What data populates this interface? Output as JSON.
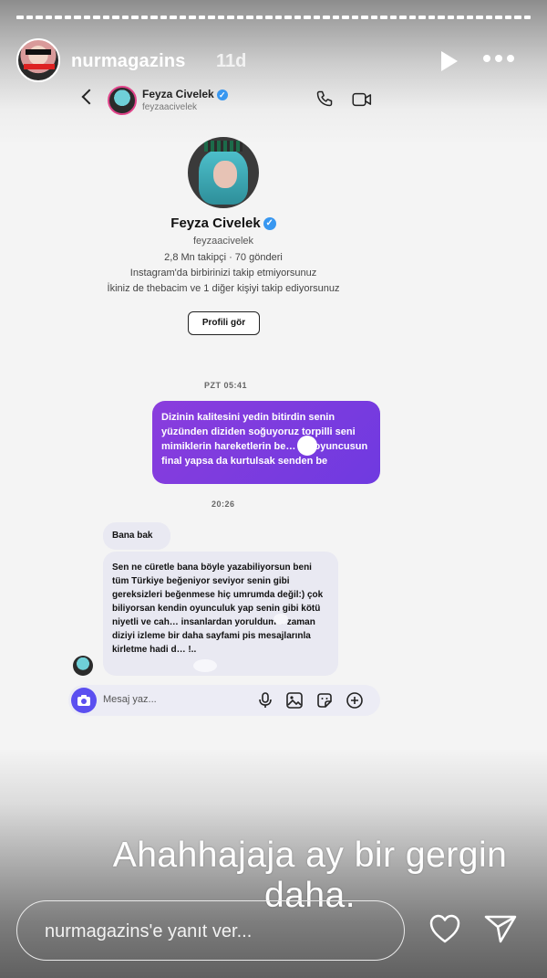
{
  "story": {
    "username": "nurmagazins",
    "time_ago": "11d",
    "overlay_text_line1": "Ahahhajaja ay bir gergin",
    "overlay_text_line2": "daha.",
    "reply_placeholder": "nurmagazins'e yanıt ver..."
  },
  "dm": {
    "header_name": "Feyza Civelek",
    "header_handle": "feyzaacivelek",
    "profile_name": "Feyza Civelek",
    "profile_handle": "feyzaacivelek",
    "stats": "2,8 Mn takipçi · 70 gönderi",
    "follow_info": "Instagram'da birbirinizi takip etmiyorsunuz",
    "mutual_info": "İkiniz de thebacim ve 1 diğer kişiyi takip ediyorsunuz",
    "profile_button": "Profili gör",
    "time_1": "PZT 05:41",
    "outgoing_message": "Dizinin kalitesini yedin bitirdin senin yüzünden diziden soğuyoruz torpilli seni mimiklerin hareketlerin be… bir oyuncusun final yapsa da kurtulsak senden be",
    "time_2": "20:26",
    "incoming_message_1": "Bana bak",
    "incoming_message_2": "Sen ne cüretle bana böyle yazabiliyorsun beni tüm Türkiye beğeniyor seviyor senin gibi gereksizleri beğenmese hiç umrumda değil:) çok biliyorsan kendin oyunculuk yap senin gibi kötü niyetli ve cah… insanlardan yoruldum o zaman diziyi izleme bir daha sayfami pis mesajlarınla kirletme hadi d… !..",
    "composer_placeholder": "Mesaj yaz..."
  },
  "colors": {
    "outgoing_bubble": "#7a3be0",
    "incoming_bubble": "#e9e9f2",
    "verified": "#3897f0",
    "camera_button": "#5b4ff0"
  },
  "icons": [
    "play-icon",
    "more-icon",
    "back-icon",
    "phone-icon",
    "video-icon",
    "camera-icon",
    "mic-icon",
    "gallery-icon",
    "sticker-icon",
    "plus-icon",
    "heart-icon",
    "send-icon",
    "verified-icon"
  ]
}
